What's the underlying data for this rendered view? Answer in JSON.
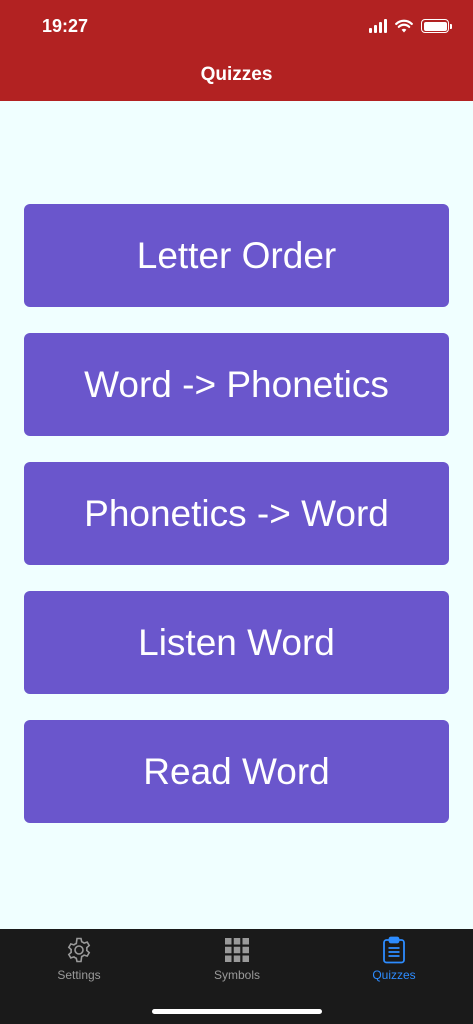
{
  "status_bar": {
    "time": "19:27"
  },
  "nav": {
    "title": "Quizzes"
  },
  "quizzes": [
    {
      "label": "Letter Order"
    },
    {
      "label": "Word -> Phonetics"
    },
    {
      "label": "Phonetics -> Word"
    },
    {
      "label": "Listen Word"
    },
    {
      "label": "Read Word"
    }
  ],
  "tabs": [
    {
      "label": "Settings",
      "icon": "gear-icon"
    },
    {
      "label": "Symbols",
      "icon": "grid-icon"
    },
    {
      "label": "Quizzes",
      "icon": "clipboard-icon",
      "active": true
    }
  ],
  "colors": {
    "header": "#B22222",
    "background": "#F0FFFF",
    "button": "#6A56CC",
    "tab_bar": "#1A1A1A",
    "tab_active": "#2D8CFF",
    "tab_inactive": "#9A9A9A"
  }
}
